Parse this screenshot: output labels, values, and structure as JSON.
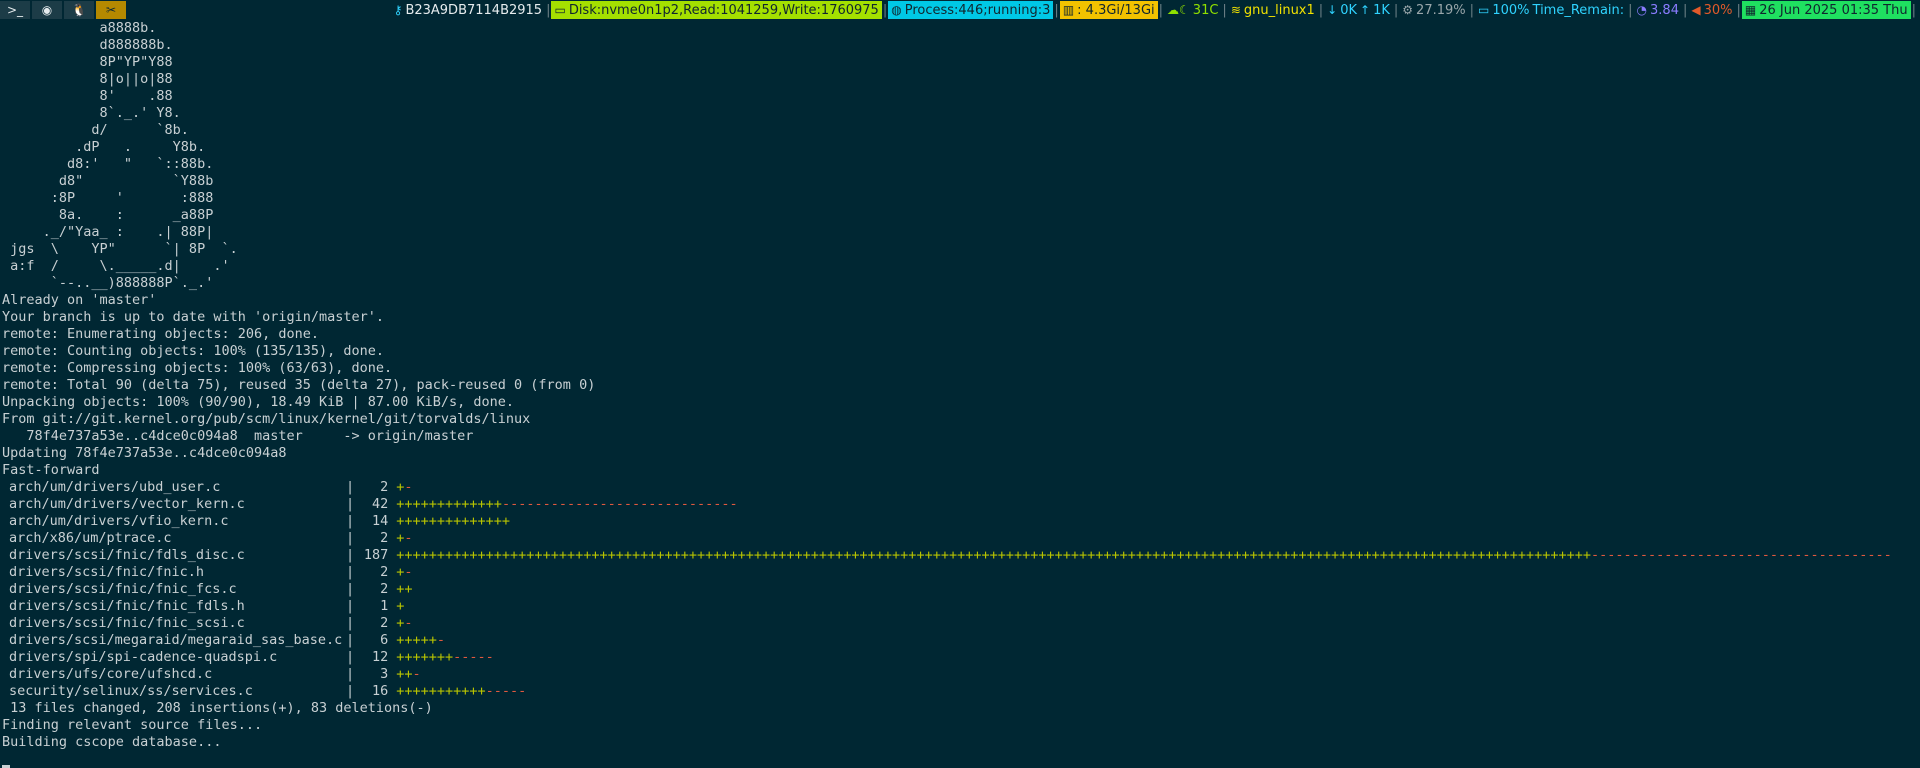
{
  "topbar": {
    "left_buttons": [
      {
        "icon": "terminal-icon",
        "glyph": ">_"
      },
      {
        "icon": "firefox-icon",
        "glyph": "◉"
      },
      {
        "icon": "linux-icon",
        "glyph": "🐧"
      },
      {
        "icon": "tools-icon",
        "glyph": "✂"
      }
    ],
    "key_id": "B23A9DB7114B2915",
    "disk": "Disk:nvme0n1p2,Read:1041259,Write:1760975",
    "process": "Process:446;running:3",
    "memory": ": 4.3Gi/13Gi",
    "temp": "31C",
    "wifi": "gnu_linux1",
    "net_down": "0K",
    "net_up": "1K",
    "cpu": "27.19%",
    "battery": "100%",
    "time_remain": "Time_Remain:",
    "load": "3.84",
    "volume": "30%",
    "datetime": "26  Jun 2025 01:35 Thu",
    "colors": {
      "disk_bg": "#a4e000",
      "process_bg": "#00c8e6",
      "memory_bg": "#f2c200",
      "datetime_bg": "#1fe060",
      "accent_text": "#2fd3ff",
      "volume": "#e25a2a",
      "load": "#8a7cff"
    }
  },
  "terminal": {
    "ascii_art": [
      "            a8888b.",
      "            d888888b.",
      "            8P\"YP\"Y88",
      "            8|o||o|88",
      "            8'    .88",
      "            8`._.' Y8.",
      "           d/      `8b.",
      "         .dP   .     Y8b.",
      "        d8:'   \"   `::88b.",
      "       d8\"           `Y88b",
      "      :8P     '       :888",
      "       8a.    :      _a88P",
      "     ._/\"Yaa_ :    .| 88P|",
      " jgs  \\    YP\"      `| 8P  `.",
      " a:f  /     \\._____.d|    .'",
      "      `--..__)888888P`._.'"
    ],
    "git_lines": [
      "Already on 'master'",
      "Your branch is up to date with 'origin/master'.",
      "remote: Enumerating objects: 206, done.",
      "remote: Counting objects: 100% (135/135), done.",
      "remote: Compressing objects: 100% (63/63), done.",
      "remote: Total 90 (delta 75), reused 35 (delta 27), pack-reused 0 (from 0)",
      "Unpacking objects: 100% (90/90), 18.49 KiB | 87.00 KiB/s, done.",
      "From git://git.kernel.org/pub/scm/linux/kernel/git/torvalds/linux",
      "   78f4e737a53e..c4dce0c094a8  master     -> origin/master",
      "Updating 78f4e737a53e..c4dce0c094a8",
      "Fast-forward"
    ],
    "diffstat": [
      {
        "file": "arch/um/drivers/ubd_user.c",
        "count": "2",
        "plus": 1,
        "minus": 1
      },
      {
        "file": "arch/um/drivers/vector_kern.c",
        "count": "42",
        "plus": 13,
        "minus": 29
      },
      {
        "file": "arch/um/drivers/vfio_kern.c",
        "count": "14",
        "plus": 14,
        "minus": 0
      },
      {
        "file": "arch/x86/um/ptrace.c",
        "count": "2",
        "plus": 1,
        "minus": 1
      },
      {
        "file": "drivers/scsi/fnic/fdls_disc.c",
        "count": "187",
        "plus": 147,
        "minus": 37
      },
      {
        "file": "drivers/scsi/fnic/fnic.h",
        "count": "2",
        "plus": 1,
        "minus": 1
      },
      {
        "file": "drivers/scsi/fnic/fnic_fcs.c",
        "count": "2",
        "plus": 2,
        "minus": 0
      },
      {
        "file": "drivers/scsi/fnic/fnic_fdls.h",
        "count": "1",
        "plus": 1,
        "minus": 0
      },
      {
        "file": "drivers/scsi/fnic/fnic_scsi.c",
        "count": "2",
        "plus": 1,
        "minus": 1
      },
      {
        "file": "drivers/scsi/megaraid/megaraid_sas_base.c",
        "count": "6",
        "plus": 5,
        "minus": 1
      },
      {
        "file": "drivers/spi/spi-cadence-quadspi.c",
        "count": "12",
        "plus": 7,
        "minus": 5
      },
      {
        "file": "drivers/ufs/core/ufshcd.c",
        "count": "3",
        "plus": 2,
        "minus": 1
      },
      {
        "file": "security/selinux/ss/services.c",
        "count": "16",
        "plus": 11,
        "minus": 5
      }
    ],
    "summary": " 13 files changed, 208 insertions(+), 83 deletions(-)",
    "tail_lines": [
      "Finding relevant source files...",
      "Building cscope database..."
    ]
  }
}
